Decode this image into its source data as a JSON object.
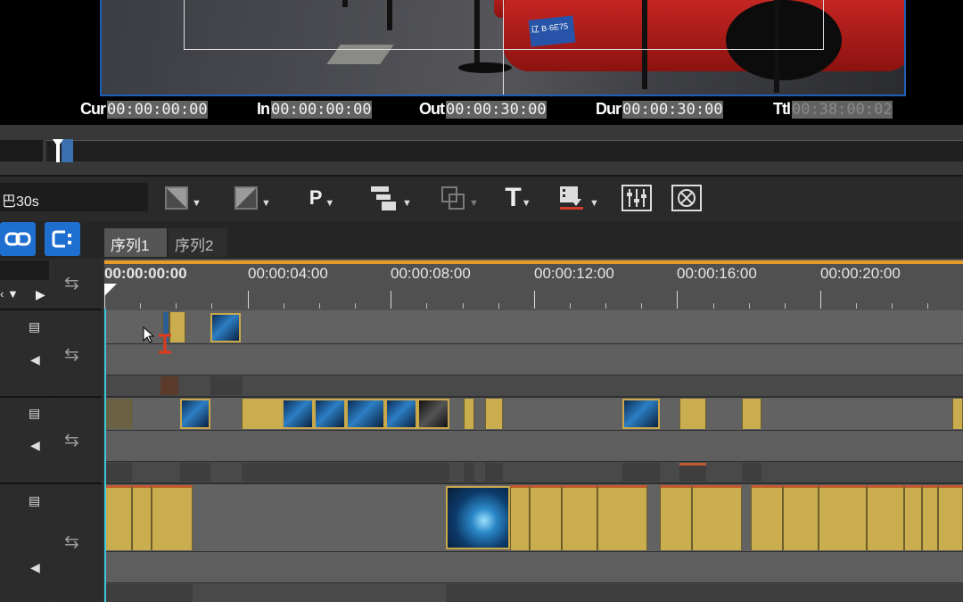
{
  "preview": {
    "timecodes": [
      {
        "label": "Cur",
        "value": "00:00:00:00"
      },
      {
        "label": "In",
        "value": "00:00:00:00"
      },
      {
        "label": "Out",
        "value": "00:00:30:00"
      },
      {
        "label": "Dur",
        "value": "00:00:30:00"
      },
      {
        "label": "Ttl",
        "value": "00:38:00:02"
      }
    ],
    "frame_plate_text": "辽 B·6E75"
  },
  "toolbar": {
    "sequence_name": "巴30s",
    "p_label": "P",
    "t_label": "T"
  },
  "sequence_tabs": [
    "序列1",
    "序列2"
  ],
  "ruler": {
    "labels": [
      "00:00:00:00",
      "00:00:04:00",
      "00:00:08:00",
      "00:00:12:00",
      "00:00:16:00",
      "00:00:20:00"
    ]
  },
  "colors": {
    "accent": "#1f6fd0",
    "clip": "#c9ad4e",
    "ruler_progress": "#e89a2a"
  }
}
